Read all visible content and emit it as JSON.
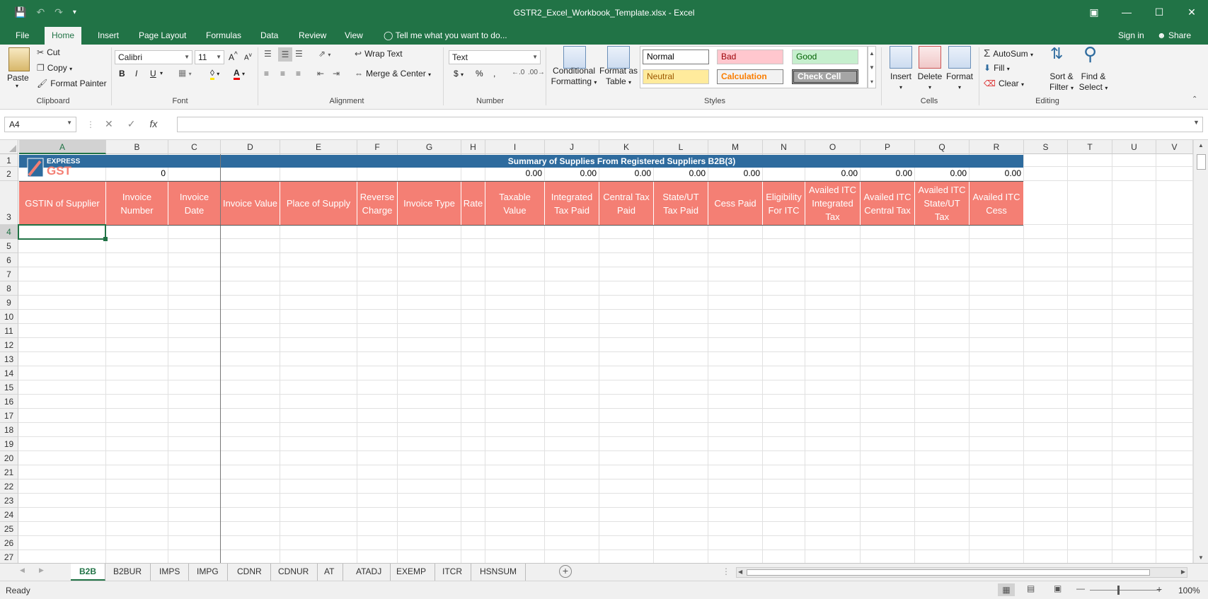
{
  "window": {
    "title": "GSTR2_Excel_Workbook_Template.xlsx - Excel"
  },
  "menu_tabs": [
    "File",
    "Home",
    "Insert",
    "Page Layout",
    "Formulas",
    "Data",
    "Review",
    "View"
  ],
  "tell_me": "Tell me what you want to do...",
  "sign_in": "Sign in",
  "share": "Share",
  "ribbon": {
    "clipboard": {
      "label": "Clipboard",
      "paste": "Paste",
      "cut": "Cut",
      "copy": "Copy",
      "format_painter": "Format Painter"
    },
    "font": {
      "label": "Font",
      "name": "Calibri",
      "size": "11",
      "bold": "B",
      "italic": "I",
      "underline": "U"
    },
    "alignment": {
      "label": "Alignment",
      "wrap_text": "Wrap Text",
      "merge_center": "Merge & Center"
    },
    "number": {
      "label": "Number",
      "format": "Text",
      "currency": "$",
      "percent": "%",
      "comma": ","
    },
    "styles": {
      "label": "Styles",
      "conditional_formatting": [
        "Conditional",
        "Formatting"
      ],
      "format_as_table": [
        "Format as",
        "Table"
      ],
      "cells": [
        {
          "name": "Normal",
          "bg": "#ffffff",
          "fg": "#000000"
        },
        {
          "name": "Bad",
          "bg": "#ffc7ce",
          "fg": "#9c0006"
        },
        {
          "name": "Good",
          "bg": "#c6efce",
          "fg": "#006100"
        },
        {
          "name": "Neutral",
          "bg": "#ffeb9c",
          "fg": "#9c5700"
        },
        {
          "name": "Calculation",
          "bg": "#f2f2f2",
          "fg": "#fa7d00"
        },
        {
          "name": "Check Cell",
          "bg": "#a5a5a5",
          "fg": "#ffffff"
        }
      ]
    },
    "cells": {
      "label": "Cells",
      "insert": "Insert",
      "delete": "Delete",
      "format": "Format"
    },
    "editing": {
      "label": "Editing",
      "autosum": "AutoSum",
      "fill": "Fill",
      "clear": "Clear",
      "sort_filter": [
        "Sort &",
        "Filter"
      ],
      "find_select": [
        "Find &",
        "Select"
      ]
    }
  },
  "formula_bar": {
    "name_box": "A4",
    "formula": ""
  },
  "columns": [
    "A",
    "B",
    "C",
    "D",
    "E",
    "F",
    "G",
    "H",
    "I",
    "J",
    "K",
    "L",
    "M",
    "N",
    "O",
    "P",
    "Q",
    "R",
    "S",
    "T",
    "U",
    "V"
  ],
  "rows": [
    "1",
    "2",
    "3",
    "4",
    "5",
    "6",
    "7",
    "8",
    "9",
    "10",
    "11",
    "12",
    "13",
    "14",
    "15",
    "16",
    "17",
    "18",
    "19",
    "20",
    "21",
    "22",
    "23",
    "24",
    "25",
    "26",
    "27"
  ],
  "sheet": {
    "logo_top": "EXPRESS",
    "logo_bottom": "GST",
    "title": "Summary of Supplies From Registered Suppliers B2B(3)",
    "row2_values": {
      "B": "0",
      "I": "0.00",
      "J": "0.00",
      "K": "0.00",
      "L": "0.00",
      "M": "0.00",
      "O": "0.00",
      "P": "0.00",
      "Q": "0.00",
      "R": "0.00"
    },
    "headers": [
      "GSTIN of Supplier",
      "Invoice Number",
      "Invoice Date",
      "Invoice Value",
      "Place of Supply",
      "Reverse Charge",
      "Invoice Type",
      "Rate",
      "Taxable Value",
      "Integrated Tax Paid",
      "Central Tax Paid",
      "State/UT Tax Paid",
      "Cess Paid",
      "Eligibility For ITC",
      "Availed ITC Integrated Tax",
      "Availed ITC Central Tax",
      "Availed ITC State/UT Tax",
      "Availed ITC Cess"
    ]
  },
  "sheet_tabs": [
    "B2B",
    "B2BUR",
    "IMPS",
    "IMPG",
    "CDNR",
    "CDNUR",
    "AT",
    "ATADJ",
    "EXEMP",
    "ITCR",
    "HSNSUM"
  ],
  "active_sheet": "B2B",
  "status": {
    "ready": "Ready",
    "zoom": "100%"
  },
  "colors": {
    "accent": "#217346",
    "title_band": "#2e6b9e",
    "header_fill": "#f47f74"
  }
}
